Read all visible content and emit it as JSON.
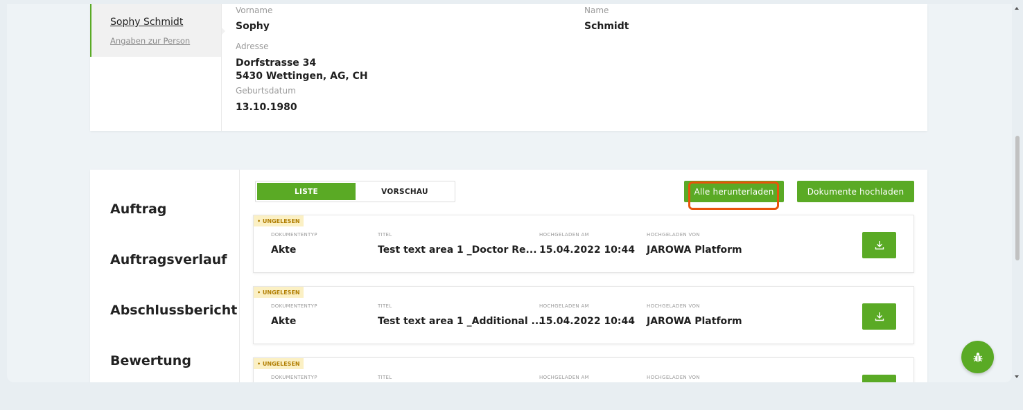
{
  "person": {
    "tab_name": "Sophy Schmidt",
    "tab_sub": "Angaben zur Person",
    "vorname_label": "Vorname",
    "vorname": "Sophy",
    "name_label": "Name",
    "name": "Schmidt",
    "adresse_label": "Adresse",
    "adresse_line1": "Dorfstrasse 34",
    "adresse_line2": "5430 Wettingen, AG, CH",
    "geburtsdatum_label": "Geburtsdatum",
    "geburtsdatum": "13.10.1980"
  },
  "nav": {
    "items": [
      {
        "label": "Auftrag"
      },
      {
        "label": "Auftragsverlauf"
      },
      {
        "label": "Abschlussbericht"
      },
      {
        "label": "Bewertung"
      }
    ]
  },
  "toolbar": {
    "tab_liste": "LISTE",
    "tab_vorschau": "VORSCHAU",
    "download_all": "Alle herunterladen",
    "upload": "Dokumente hochladen"
  },
  "columns": {
    "type": "DOKUMENTENTYP",
    "title": "TITEL",
    "uploaded_at": "HOCHGELADEN AM",
    "uploaded_by": "HOCHGELADEN VON"
  },
  "documents": [
    {
      "badge": "• UNGELESEN",
      "type": "Akte",
      "title": "Test text area 1 _Doctor Re...",
      "uploaded_at": "15.04.2022 10:44",
      "uploaded_by": "JAROWA Platform"
    },
    {
      "badge": "• UNGELESEN",
      "type": "Akte",
      "title": "Test text area 1 _Additional ...",
      "uploaded_at": "15.04.2022 10:44",
      "uploaded_by": "JAROWA Platform"
    },
    {
      "badge": "• UNGELESEN",
      "type": "",
      "title": "",
      "uploaded_at": "",
      "uploaded_by": ""
    }
  ],
  "colors": {
    "accent": "#5aaa25",
    "highlight": "#e8540b",
    "badge_bg": "#fbf0c4"
  },
  "icons": {
    "download": "download-icon",
    "bug": "bug-icon"
  }
}
